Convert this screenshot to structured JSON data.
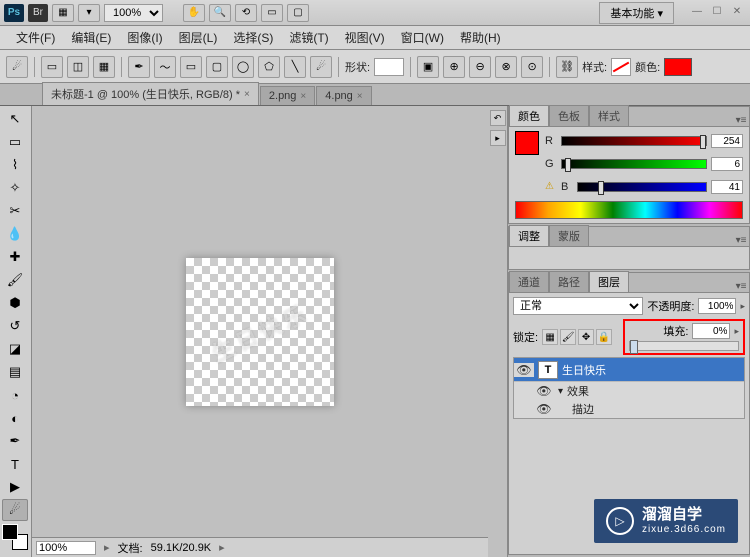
{
  "app_bar": {
    "zoom": "100%",
    "workspace": "基本功能"
  },
  "menu": {
    "file": "文件(F)",
    "edit": "编辑(E)",
    "image": "图像(I)",
    "layer": "图层(L)",
    "select": "选择(S)",
    "filter": "滤镜(T)",
    "view": "视图(V)",
    "window": "窗口(W)",
    "help": "帮助(H)"
  },
  "options": {
    "shape_label": "形状:",
    "style_label": "样式:",
    "color_label": "颜色:"
  },
  "tabs": {
    "t1": "未标题-1 @ 100% (生日快乐, RGB/8) *",
    "t2": "2.png",
    "t3": "4.png"
  },
  "canvas": {
    "text": "生日快乐"
  },
  "status": {
    "zoom": "100%",
    "doc_label": "文档:",
    "doc_size": "59.1K/20.9K"
  },
  "color_panel": {
    "tab_color": "颜色",
    "tab_swatch": "色板",
    "tab_style": "样式",
    "r": "254",
    "g": "6",
    "b": "41"
  },
  "adjust_panel": {
    "tab_adjust": "调整",
    "tab_mask": "蒙版"
  },
  "layers_panel": {
    "tab_channels": "通道",
    "tab_paths": "路径",
    "tab_layers": "图层",
    "blend": "正常",
    "opacity_label": "不透明度:",
    "opacity_val": "100%",
    "lock_label": "锁定:",
    "fill_label": "填充:",
    "fill_val": "0%",
    "layer_name": "生日快乐",
    "fx_label": "效果",
    "fx_stroke": "描边"
  },
  "watermark": {
    "big": "溜溜自学",
    "small": "zixue.3d66.com"
  }
}
